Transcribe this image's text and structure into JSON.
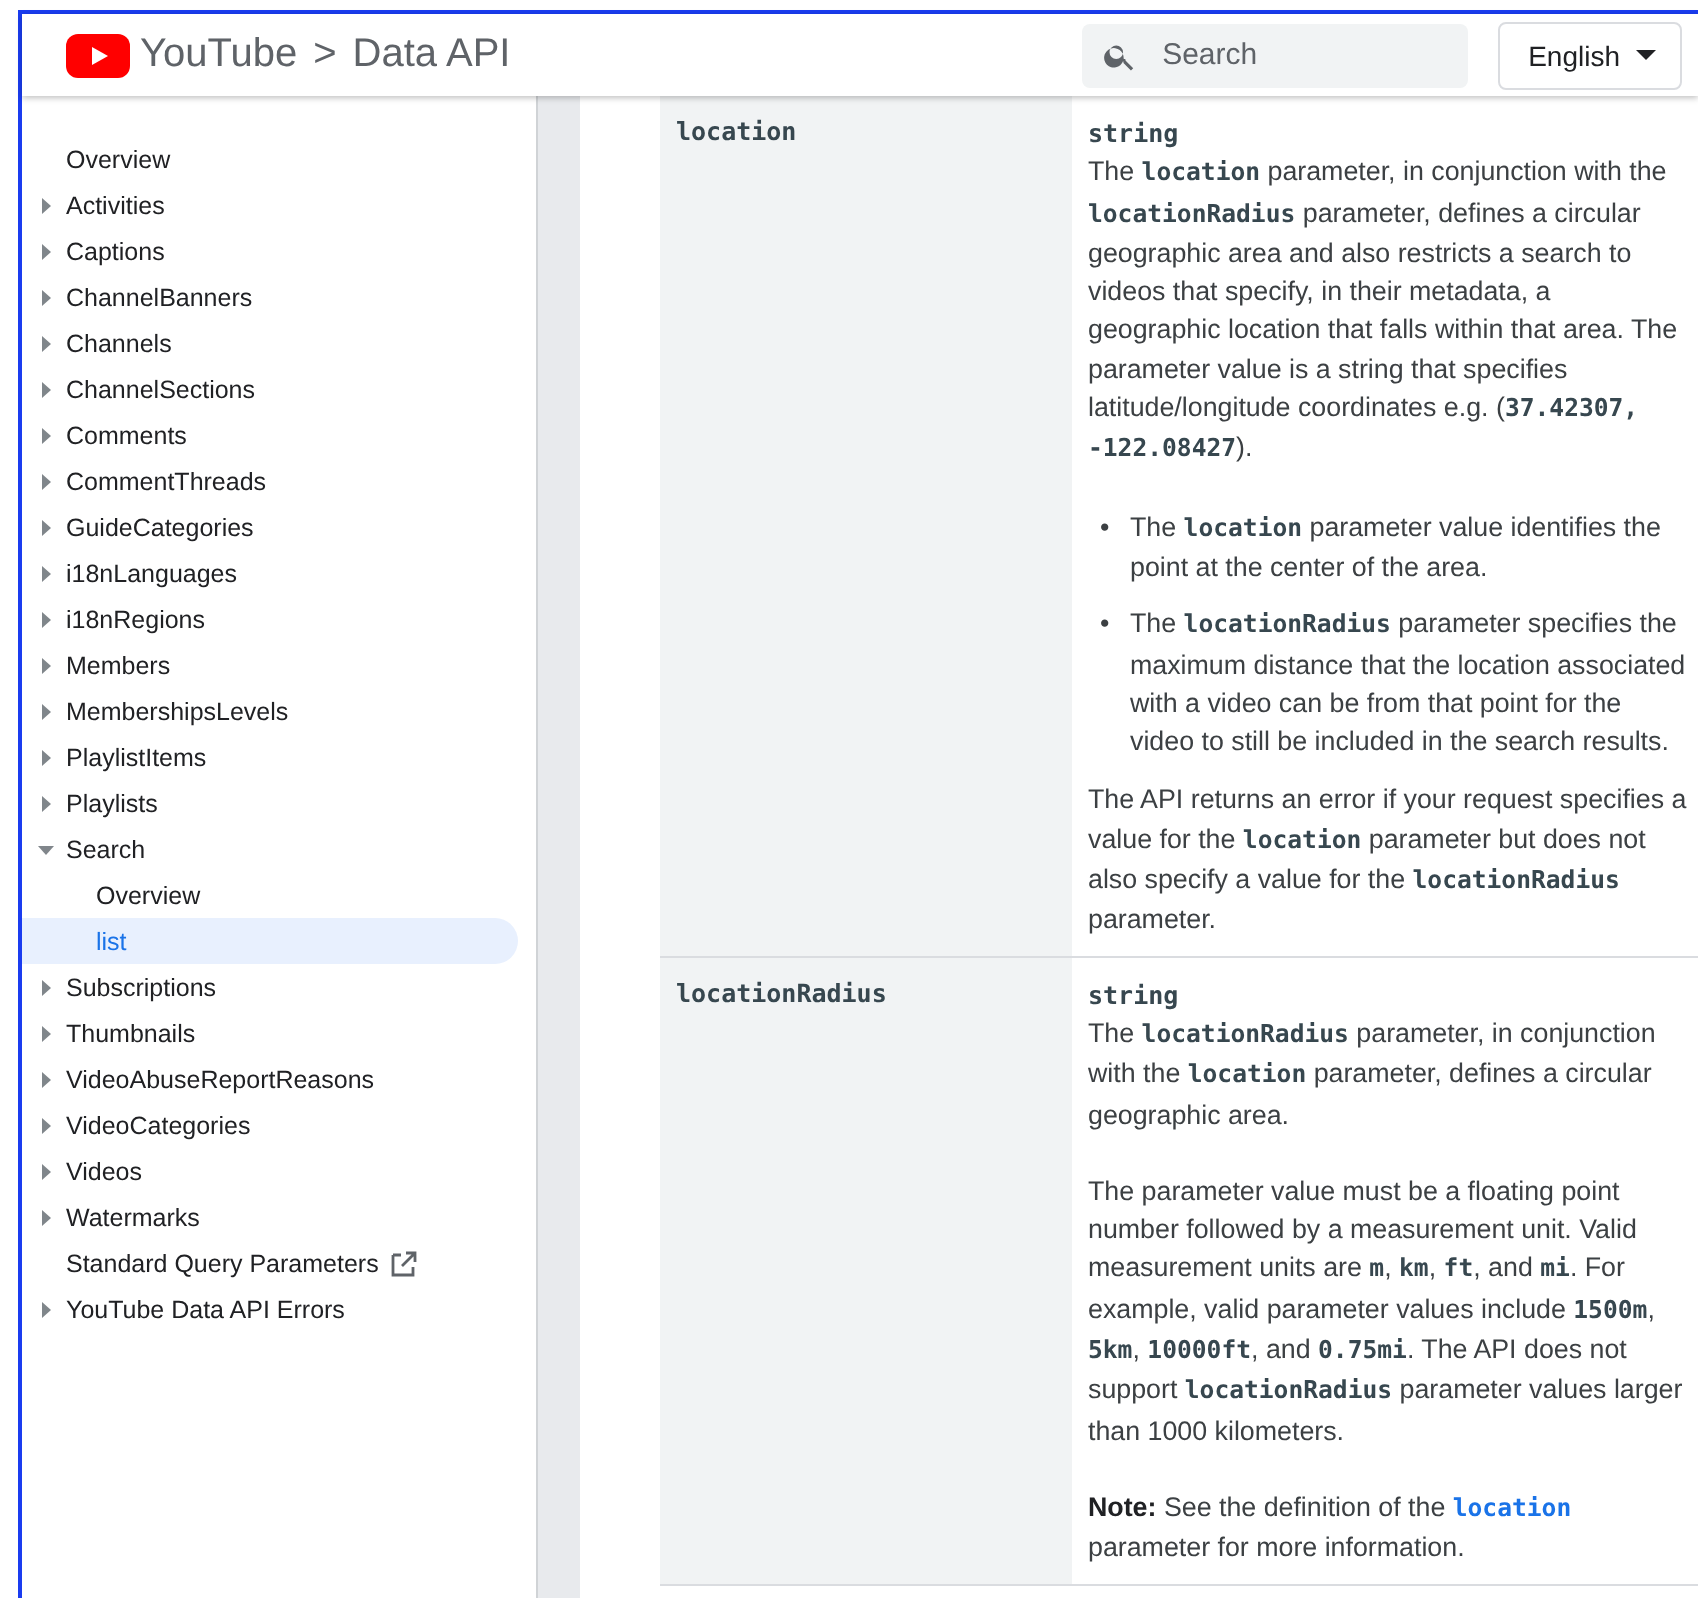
{
  "header": {
    "brand": "YouTube",
    "separator": ">",
    "product": "Data API",
    "search": {
      "placeholder": "Search"
    },
    "language": "English"
  },
  "sidebar": {
    "items": [
      {
        "label": "Overview",
        "kind": "page",
        "expanded": false,
        "selected": false
      },
      {
        "label": "Activities",
        "kind": "group",
        "expanded": false,
        "selected": false
      },
      {
        "label": "Captions",
        "kind": "group",
        "expanded": false,
        "selected": false
      },
      {
        "label": "ChannelBanners",
        "kind": "group",
        "expanded": false,
        "selected": false
      },
      {
        "label": "Channels",
        "kind": "group",
        "expanded": false,
        "selected": false
      },
      {
        "label": "ChannelSections",
        "kind": "group",
        "expanded": false,
        "selected": false
      },
      {
        "label": "Comments",
        "kind": "group",
        "expanded": false,
        "selected": false
      },
      {
        "label": "CommentThreads",
        "kind": "group",
        "expanded": false,
        "selected": false
      },
      {
        "label": "GuideCategories",
        "kind": "group",
        "expanded": false,
        "selected": false
      },
      {
        "label": "i18nLanguages",
        "kind": "group",
        "expanded": false,
        "selected": false
      },
      {
        "label": "i18nRegions",
        "kind": "group",
        "expanded": false,
        "selected": false
      },
      {
        "label": "Members",
        "kind": "group",
        "expanded": false,
        "selected": false
      },
      {
        "label": "MembershipsLevels",
        "kind": "group",
        "expanded": false,
        "selected": false
      },
      {
        "label": "PlaylistItems",
        "kind": "group",
        "expanded": false,
        "selected": false
      },
      {
        "label": "Playlists",
        "kind": "group",
        "expanded": false,
        "selected": false
      },
      {
        "label": "Search",
        "kind": "group",
        "expanded": true,
        "selected": false,
        "children": [
          {
            "label": "Overview",
            "selected": false
          },
          {
            "label": "list",
            "selected": true
          }
        ]
      },
      {
        "label": "Subscriptions",
        "kind": "group",
        "expanded": false,
        "selected": false
      },
      {
        "label": "Thumbnails",
        "kind": "group",
        "expanded": false,
        "selected": false
      },
      {
        "label": "VideoAbuseReportReasons",
        "kind": "group",
        "expanded": false,
        "selected": false
      },
      {
        "label": "VideoCategories",
        "kind": "group",
        "expanded": false,
        "selected": false
      },
      {
        "label": "Videos",
        "kind": "group",
        "expanded": false,
        "selected": false
      },
      {
        "label": "Watermarks",
        "kind": "group",
        "expanded": false,
        "selected": false
      },
      {
        "label": "Standard Query Parameters",
        "kind": "external",
        "expanded": false,
        "selected": false
      },
      {
        "label": "YouTube Data API Errors",
        "kind": "group",
        "expanded": false,
        "selected": false
      }
    ]
  },
  "parameters": [
    {
      "name": "location",
      "type": "string",
      "blocks": [
        {
          "kind": "para",
          "segments": [
            {
              "kind": "text",
              "text": "The "
            },
            {
              "kind": "code",
              "text": "location"
            },
            {
              "kind": "text",
              "text": " parameter, in conjunction with the "
            },
            {
              "kind": "code",
              "text": "locationRadius"
            },
            {
              "kind": "text",
              "text": " parameter, defines a circular geographic area and also restricts a search to videos that specify, in their metadata, a geographic location that falls within that area. The parameter value is a string that specifies latitude/longitude coordinates e.g. ("
            },
            {
              "kind": "code",
              "text": "37.42307, -122.08427"
            },
            {
              "kind": "text",
              "text": ")."
            }
          ]
        },
        {
          "kind": "list",
          "marker": "•",
          "items": [
            [
              {
                "kind": "text",
                "text": "The "
              },
              {
                "kind": "code",
                "text": "location"
              },
              {
                "kind": "text",
                "text": " parameter value identifies the point at the center of the area."
              }
            ],
            [
              {
                "kind": "text",
                "text": "The "
              },
              {
                "kind": "code",
                "text": "locationRadius"
              },
              {
                "kind": "text",
                "text": " parameter specifies the maximum distance that the location associated with a video can be from that point for the video to still be included in the search results."
              }
            ]
          ]
        },
        {
          "kind": "para",
          "segments": [
            {
              "kind": "text",
              "text": "The API returns an error if your request specifies a value for the "
            },
            {
              "kind": "code",
              "text": "location"
            },
            {
              "kind": "text",
              "text": " parameter but does not also specify a value for the "
            },
            {
              "kind": "code",
              "text": "locationRadius"
            },
            {
              "kind": "text",
              "text": " parameter."
            }
          ]
        }
      ]
    },
    {
      "name": "locationRadius",
      "type": "string",
      "blocks": [
        {
          "kind": "para",
          "segments": [
            {
              "kind": "text",
              "text": "The "
            },
            {
              "kind": "code",
              "text": "locationRadius"
            },
            {
              "kind": "text",
              "text": " parameter, in conjunction with the "
            },
            {
              "kind": "code",
              "text": "location"
            },
            {
              "kind": "text",
              "text": " parameter, defines a circular geographic area."
            }
          ]
        },
        {
          "kind": "para",
          "segments": [
            {
              "kind": "text",
              "text": "The parameter value must be a floating point number followed by a measurement unit. Valid measurement units are "
            },
            {
              "kind": "code",
              "text": "m"
            },
            {
              "kind": "text",
              "text": ", "
            },
            {
              "kind": "code",
              "text": "km"
            },
            {
              "kind": "text",
              "text": ", "
            },
            {
              "kind": "code",
              "text": "ft"
            },
            {
              "kind": "text",
              "text": ", and "
            },
            {
              "kind": "code",
              "text": "mi"
            },
            {
              "kind": "text",
              "text": ". For example, valid parameter values include "
            },
            {
              "kind": "code",
              "text": "1500m"
            },
            {
              "kind": "text",
              "text": ", "
            },
            {
              "kind": "code",
              "text": "5km"
            },
            {
              "kind": "text",
              "text": ", "
            },
            {
              "kind": "code",
              "text": "10000ft"
            },
            {
              "kind": "text",
              "text": ", and "
            },
            {
              "kind": "code",
              "text": "0.75mi"
            },
            {
              "kind": "text",
              "text": ". The API does not support "
            },
            {
              "kind": "code",
              "text": "locationRadius"
            },
            {
              "kind": "text",
              "text": " parameter values larger than 1000 kilometers."
            }
          ]
        },
        {
          "kind": "para",
          "segments": [
            {
              "kind": "bold",
              "text": "Note:"
            },
            {
              "kind": "text",
              "text": " See the definition of the "
            },
            {
              "kind": "link",
              "text": "location"
            },
            {
              "kind": "text",
              "text": " parameter for more information."
            }
          ]
        }
      ]
    }
  ]
}
